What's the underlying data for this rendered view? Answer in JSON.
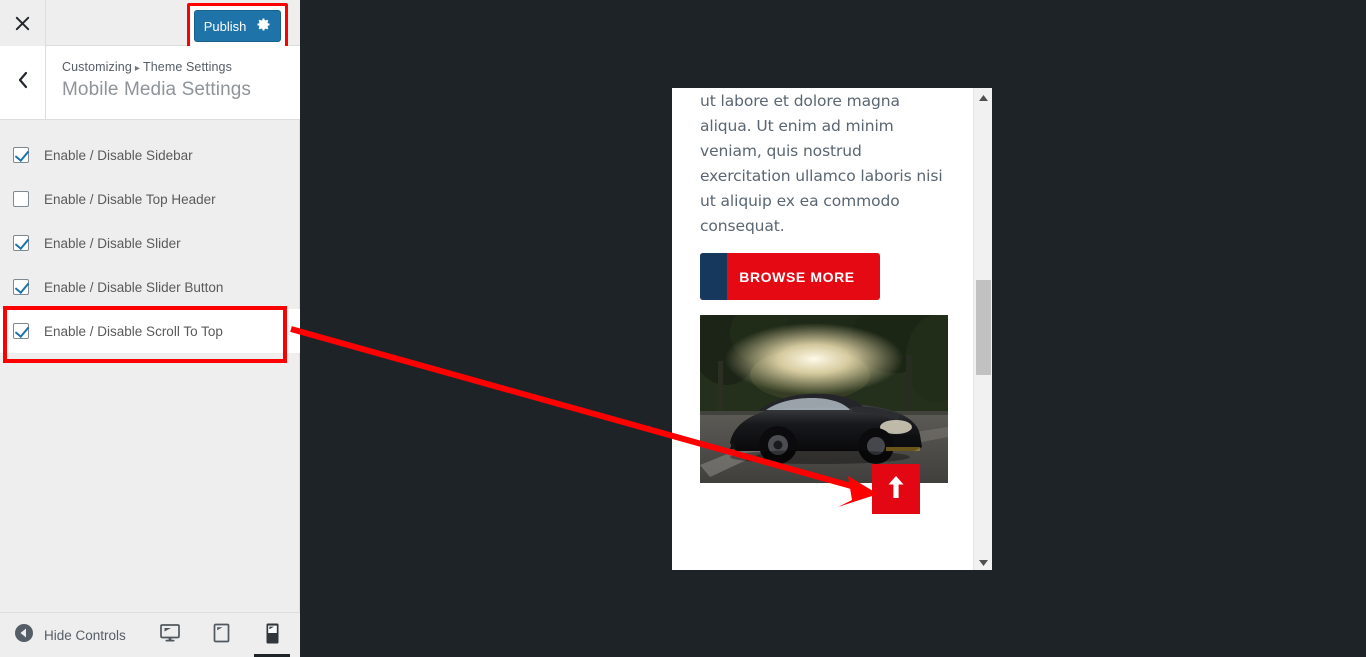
{
  "app": {
    "name": "WordPress Customizer",
    "dark_bg": "#1e2327",
    "accent_blue": "#1e73a8",
    "annotation_red": "#ff0000"
  },
  "header": {
    "close_icon": "close-icon",
    "publish_label": "Publish",
    "publish_gear_icon": "gear-icon",
    "publish_bg": "#1e73a8"
  },
  "panel": {
    "back_icon": "chevron-left-icon",
    "breadcrumb_root": "Customizing",
    "breadcrumb_separator": "▸",
    "breadcrumb_parent": "Theme Settings",
    "title": "Mobile Media Settings"
  },
  "settings": {
    "checkboxes": [
      {
        "label": "Enable / Disable Sidebar",
        "checked": true,
        "highlighted": false
      },
      {
        "label": "Enable / Disable Top Header",
        "checked": false,
        "highlighted": false
      },
      {
        "label": "Enable / Disable Slider",
        "checked": true,
        "highlighted": false
      },
      {
        "label": "Enable / Disable Slider Button",
        "checked": true,
        "highlighted": false
      },
      {
        "label": "Enable / Disable Scroll To Top",
        "checked": true,
        "highlighted": true
      }
    ]
  },
  "footer": {
    "hide_controls_label": "Hide Controls",
    "hide_controls_icon": "caret-left-circle-icon",
    "devices": [
      {
        "name": "desktop",
        "icon": "desktop-icon",
        "active": false
      },
      {
        "name": "tablet",
        "icon": "tablet-icon",
        "active": false
      },
      {
        "name": "mobile",
        "icon": "mobile-icon",
        "active": true
      }
    ]
  },
  "preview": {
    "device": "mobile",
    "body_text": "ut labore et dolore magna aliqua. Ut enim ad minim veniam, quis nostrud exercitation ullamco laboris nisi ut aliquip ex ea commodo consequat.",
    "browse_button_label": "BROWSE MORE",
    "browse_button_color": "#e50914",
    "browse_button_accent": "#16385c",
    "image_alt": "black sports car parked at sunset",
    "scroll_top_icon": "arrow-up-icon",
    "scroll_top_color": "#e30613",
    "scrollbar": {
      "up_arrow_icon": "caret-up-icon",
      "down_arrow_icon": "caret-down-icon"
    }
  }
}
